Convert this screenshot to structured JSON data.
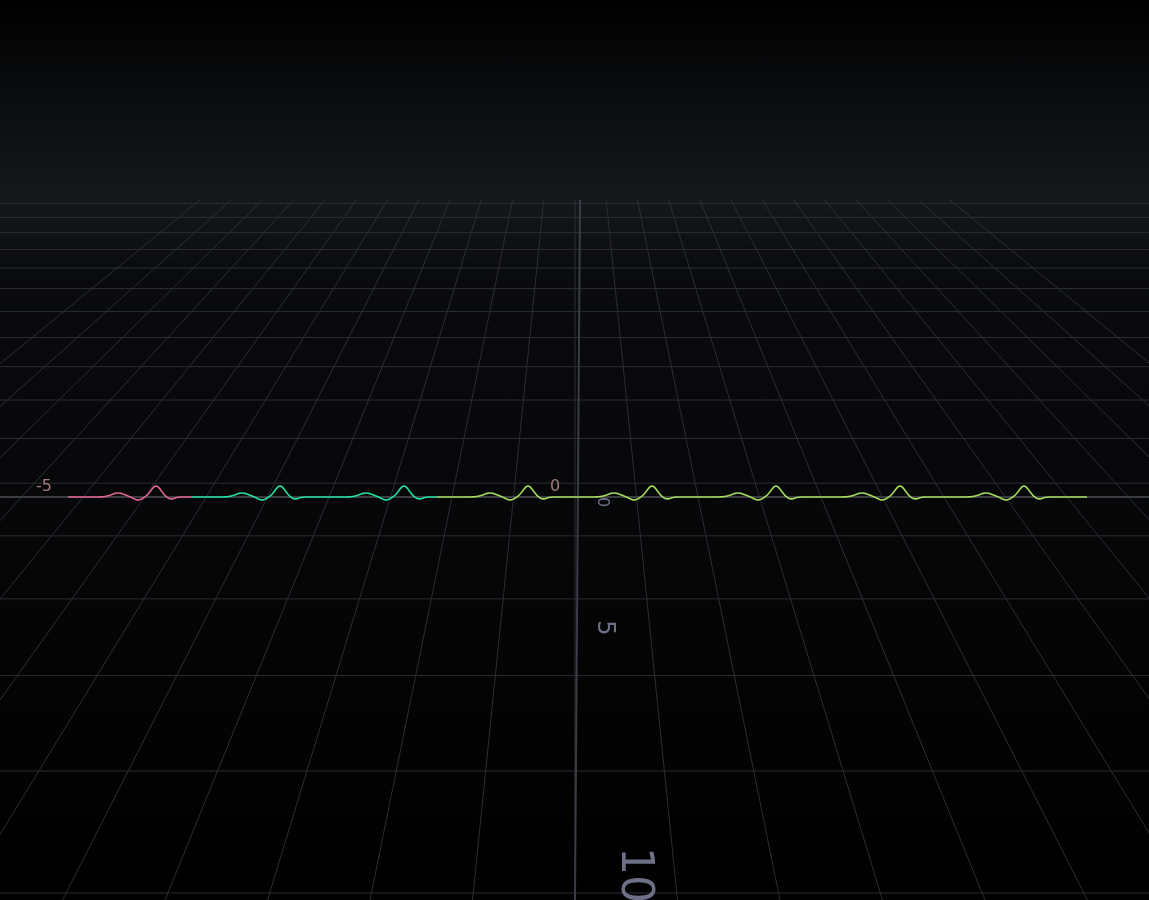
{
  "viewport": {
    "axis_labels": [
      {
        "kind": "x-axis",
        "text": "-5"
      },
      {
        "kind": "x-axis",
        "text": "0"
      },
      {
        "kind": "z-axis",
        "text": "0"
      },
      {
        "kind": "z-axis",
        "text": "5"
      },
      {
        "kind": "z-axis",
        "text": "10"
      }
    ],
    "curve": {
      "segments": [
        {
          "color": "#e06690"
        },
        {
          "color": "#22e0a2"
        },
        {
          "color": "#a6dc5c"
        }
      ]
    }
  }
}
